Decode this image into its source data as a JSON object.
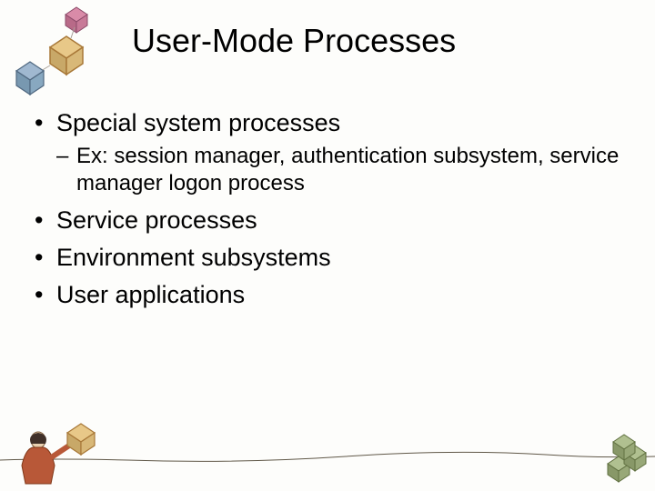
{
  "title": "User-Mode Processes",
  "bullets": {
    "item0": "Special system processes",
    "sub0": "Ex: session manager, authentication subsystem, service manager logon process",
    "item1": "Service processes",
    "item2": "Environment subsystems",
    "item3": "User applications"
  }
}
